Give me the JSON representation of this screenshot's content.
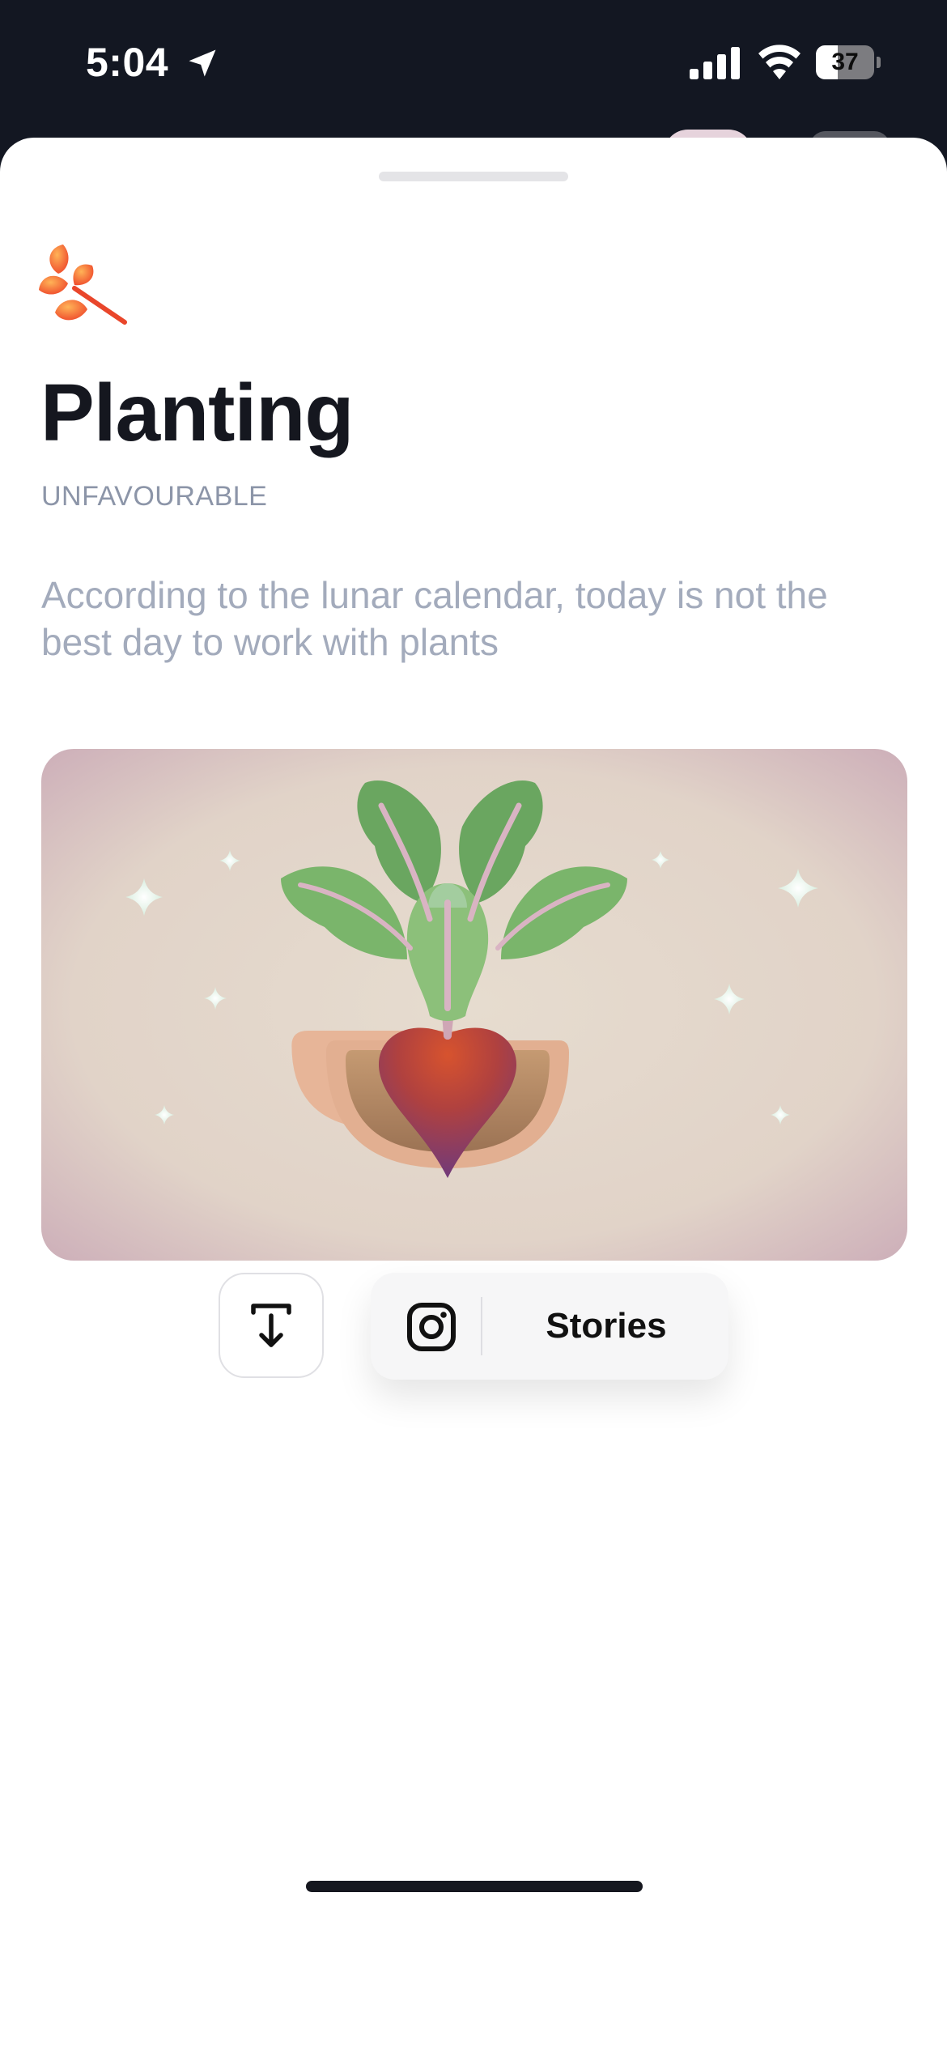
{
  "status_bar": {
    "time": "5:04",
    "battery_level": 37,
    "battery_text": "37",
    "icons": [
      "location-arrow-icon",
      "cellular-signal-icon",
      "wifi-icon",
      "battery-icon"
    ]
  },
  "sheet": {
    "icon": "orange-leaf-icon",
    "title": "Planting",
    "status": "UNFAVOURABLE",
    "description": "According to the lunar calendar, today is not the best day to work with plants",
    "illustration": "beetroot-in-pot-illustration"
  },
  "actions": {
    "export_icon": "export-down-icon",
    "share_icon": "instagram-icon",
    "share_label": "Stories"
  },
  "colors": {
    "title": "#15171f",
    "muted_text": "#8c95a8",
    "description": "#a3abbc",
    "accent_orange": "#ef5a2a",
    "illustration_bg": "#e4d8cc"
  }
}
